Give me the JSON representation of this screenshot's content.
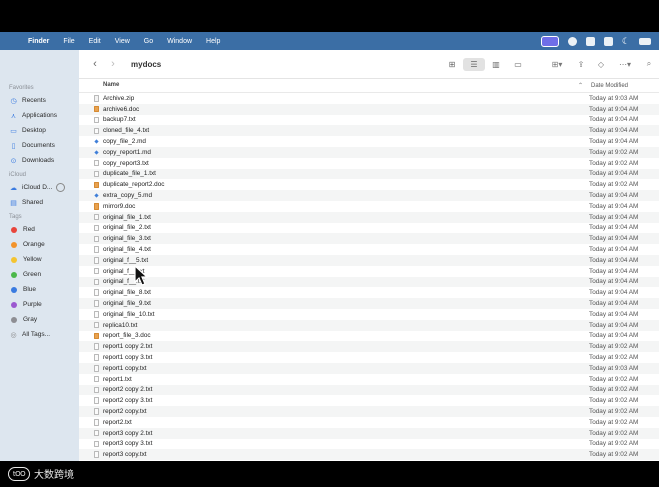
{
  "menubar": {
    "app": "Finder",
    "items": [
      "File",
      "Edit",
      "View",
      "Go",
      "Window",
      "Help"
    ]
  },
  "sidebar": {
    "favorites_label": "Favorites",
    "favorites": [
      {
        "label": "Recents",
        "icon": "clock-icon"
      },
      {
        "label": "Applications",
        "icon": "applications-icon"
      },
      {
        "label": "Desktop",
        "icon": "desktop-icon"
      },
      {
        "label": "Documents",
        "icon": "document-icon"
      },
      {
        "label": "Downloads",
        "icon": "download-icon"
      }
    ],
    "icloud_label": "iCloud",
    "icloud": [
      {
        "label": "iCloud D...",
        "icon": "cloud-icon"
      },
      {
        "label": "Shared",
        "icon": "shared-folder-icon"
      }
    ],
    "tags_label": "Tags",
    "tags": [
      {
        "label": "Red",
        "color": "#e8453c"
      },
      {
        "label": "Orange",
        "color": "#f2932b"
      },
      {
        "label": "Yellow",
        "color": "#f4c430"
      },
      {
        "label": "Green",
        "color": "#4cb84a"
      },
      {
        "label": "Blue",
        "color": "#3a7be0"
      },
      {
        "label": "Purple",
        "color": "#9b59d0"
      },
      {
        "label": "Gray",
        "color": "#8e8e93"
      }
    ],
    "all_tags": "All Tags..."
  },
  "toolbar": {
    "title": "mydocs"
  },
  "columns": {
    "name": "Name",
    "date": "Date Modified"
  },
  "files": [
    {
      "name": "Archive.zip",
      "date": "Today at 9:03 AM",
      "type": "zip"
    },
    {
      "name": "archive6.doc",
      "date": "Today at 9:04 AM",
      "type": "doc"
    },
    {
      "name": "backup7.txt",
      "date": "Today at 9:04 AM",
      "type": "txt"
    },
    {
      "name": "cloned_file_4.txt",
      "date": "Today at 9:04 AM",
      "type": "txt"
    },
    {
      "name": "copy_file_2.md",
      "date": "Today at 9:04 AM",
      "type": "md"
    },
    {
      "name": "copy_report1.md",
      "date": "Today at 9:02 AM",
      "type": "md"
    },
    {
      "name": "copy_report3.txt",
      "date": "Today at 9:02 AM",
      "type": "txt"
    },
    {
      "name": "duplicate_file_1.txt",
      "date": "Today at 9:04 AM",
      "type": "txt"
    },
    {
      "name": "duplicate_report2.doc",
      "date": "Today at 9:02 AM",
      "type": "doc"
    },
    {
      "name": "extra_copy_5.md",
      "date": "Today at 9:04 AM",
      "type": "md"
    },
    {
      "name": "mirror9.doc",
      "date": "Today at 9:04 AM",
      "type": "doc"
    },
    {
      "name": "original_file_1.txt",
      "date": "Today at 9:04 AM",
      "type": "txt"
    },
    {
      "name": "original_file_2.txt",
      "date": "Today at 9:04 AM",
      "type": "txt"
    },
    {
      "name": "original_file_3.txt",
      "date": "Today at 9:04 AM",
      "type": "txt"
    },
    {
      "name": "original_file_4.txt",
      "date": "Today at 9:04 AM",
      "type": "txt"
    },
    {
      "name": "original_f__5.txt",
      "date": "Today at 9:04 AM",
      "type": "txt"
    },
    {
      "name": "original_f__.txt",
      "date": "Today at 9:04 AM",
      "type": "txt"
    },
    {
      "name": "original_f__.txt",
      "date": "Today at 9:04 AM",
      "type": "txt"
    },
    {
      "name": "original_file_8.txt",
      "date": "Today at 9:04 AM",
      "type": "txt"
    },
    {
      "name": "original_file_9.txt",
      "date": "Today at 9:04 AM",
      "type": "txt"
    },
    {
      "name": "original_file_10.txt",
      "date": "Today at 9:04 AM",
      "type": "txt"
    },
    {
      "name": "replica10.txt",
      "date": "Today at 9:04 AM",
      "type": "txt"
    },
    {
      "name": "report_file_3.doc",
      "date": "Today at 9:04 AM",
      "type": "doc"
    },
    {
      "name": "report1 copy 2.txt",
      "date": "Today at 9:02 AM",
      "type": "txt"
    },
    {
      "name": "report1 copy 3.txt",
      "date": "Today at 9:02 AM",
      "type": "txt"
    },
    {
      "name": "report1 copy.txt",
      "date": "Today at 9:03 AM",
      "type": "txt"
    },
    {
      "name": "report1.txt",
      "date": "Today at 9:02 AM",
      "type": "txt"
    },
    {
      "name": "report2 copy 2.txt",
      "date": "Today at 9:02 AM",
      "type": "txt"
    },
    {
      "name": "report2 copy 3.txt",
      "date": "Today at 9:02 AM",
      "type": "txt"
    },
    {
      "name": "report2 copy.txt",
      "date": "Today at 9:02 AM",
      "type": "txt"
    },
    {
      "name": "report2.txt",
      "date": "Today at 9:02 AM",
      "type": "txt"
    },
    {
      "name": "report3 copy 2.txt",
      "date": "Today at 9:02 AM",
      "type": "txt"
    },
    {
      "name": "report3 copy 3.txt",
      "date": "Today at 9:02 AM",
      "type": "txt"
    },
    {
      "name": "report3 copy.txt",
      "date": "Today at 9:02 AM",
      "type": "txt"
    }
  ],
  "watermark": {
    "logo": "tOO",
    "text": "大数跨境"
  }
}
